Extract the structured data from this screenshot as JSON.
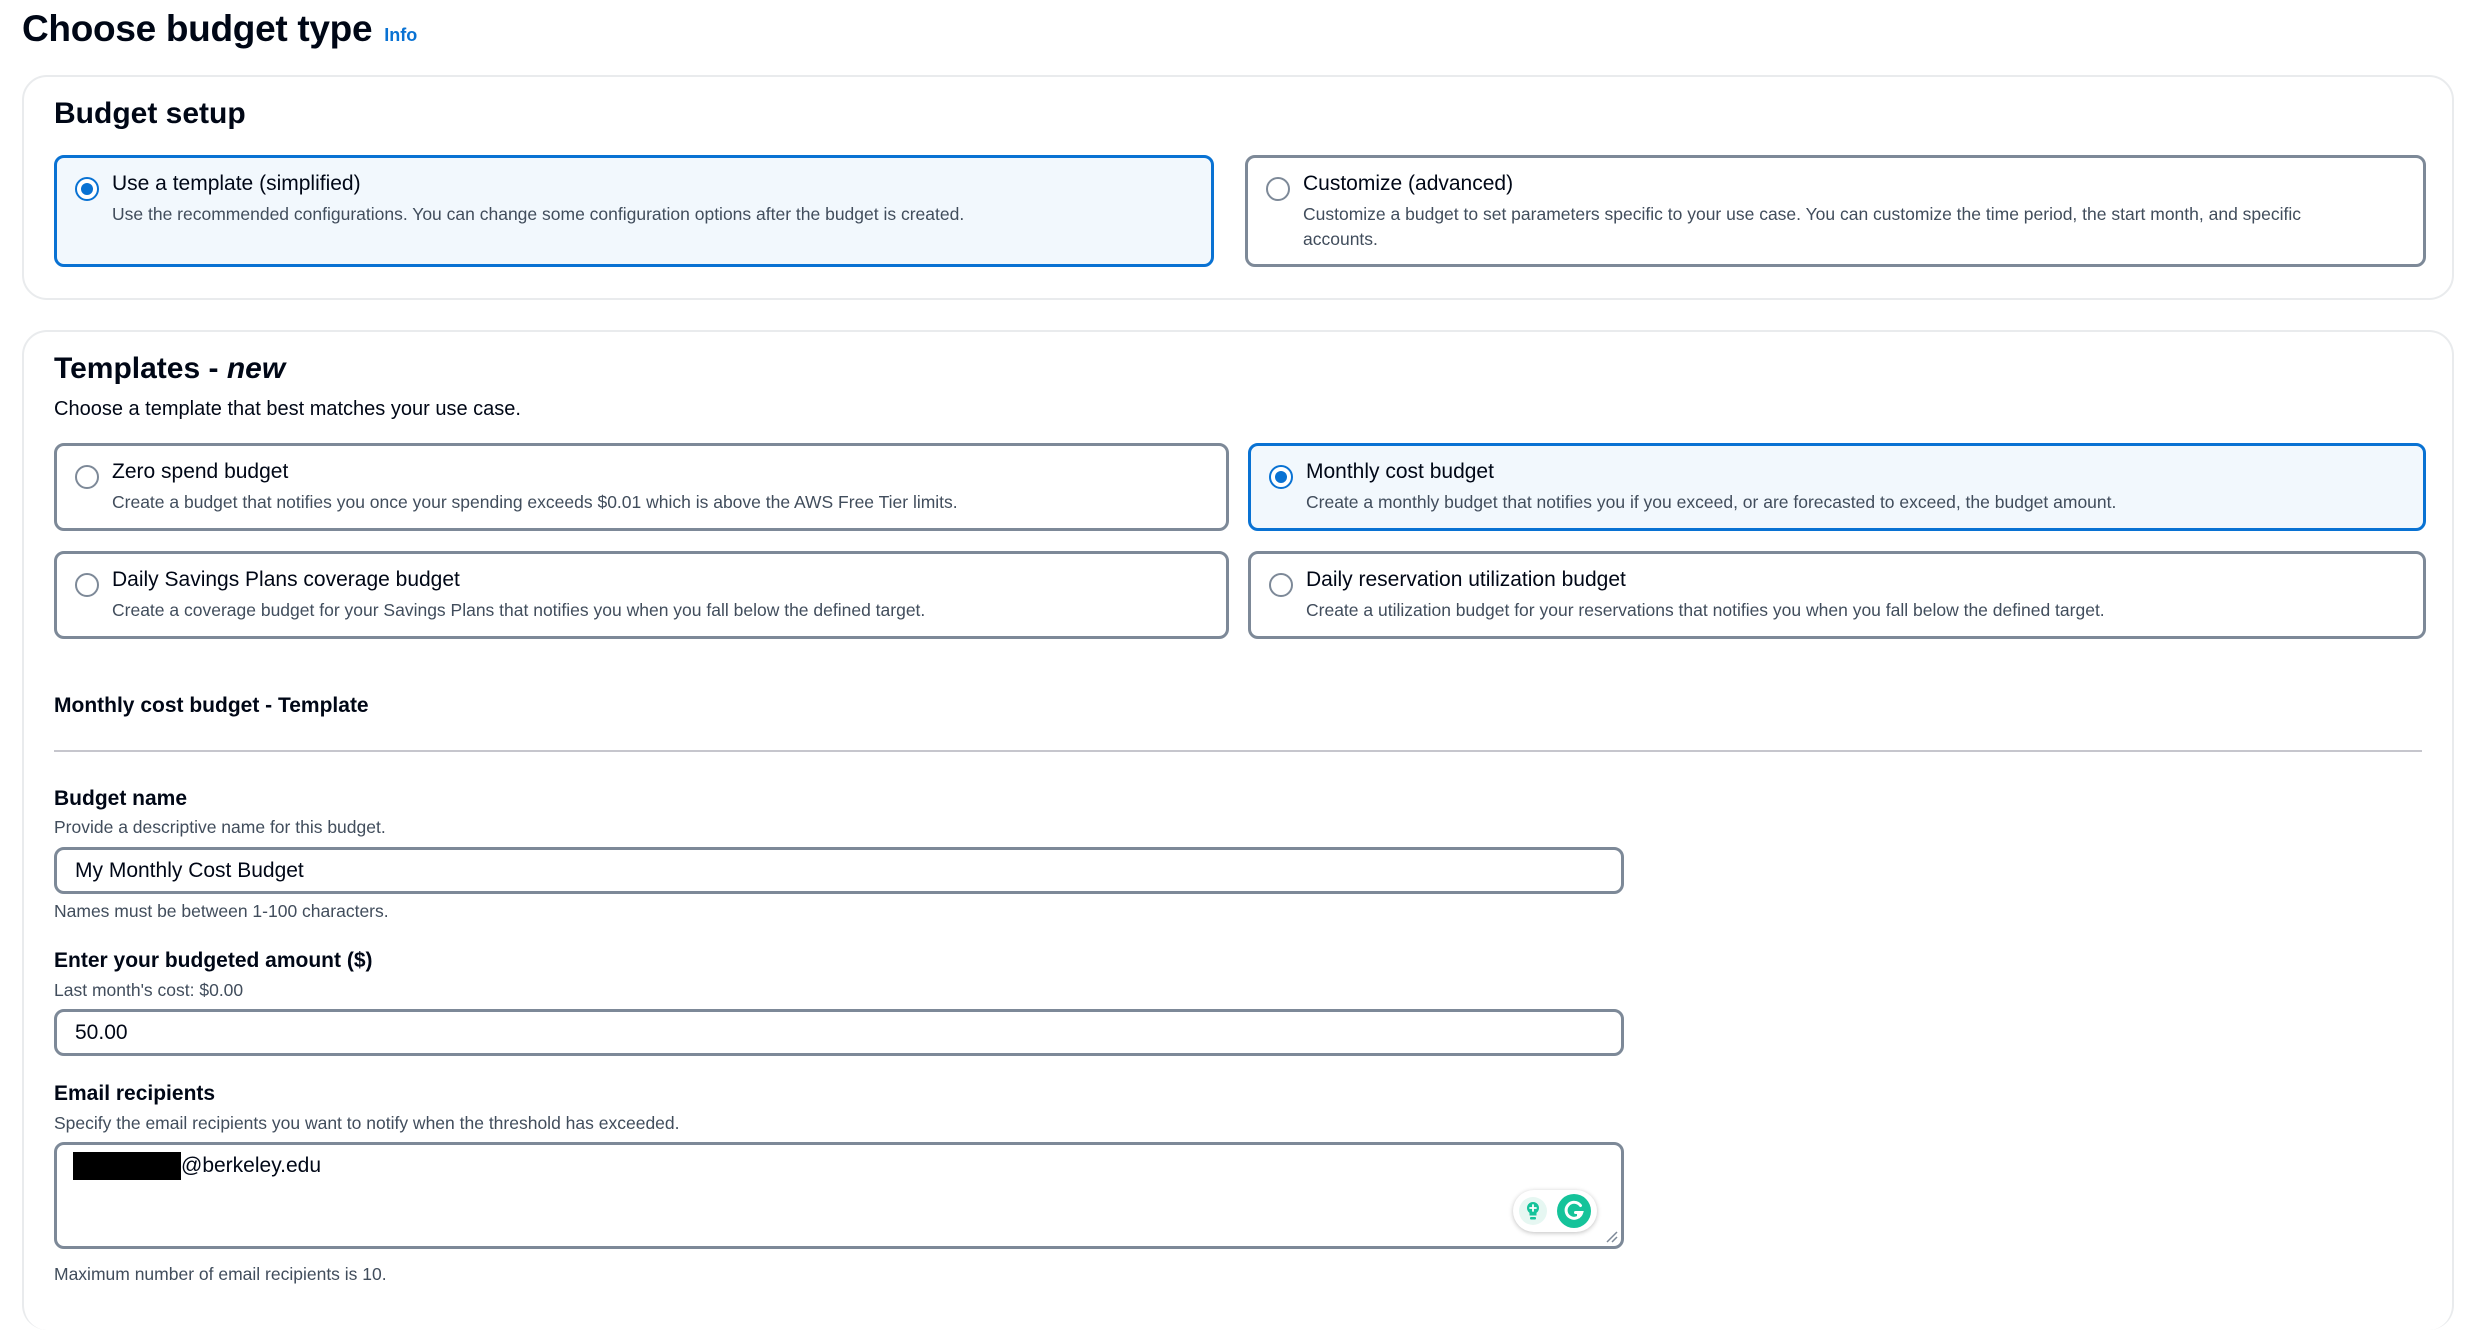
{
  "header": {
    "title": "Choose budget type",
    "info_link": "Info"
  },
  "budget_setup": {
    "heading": "Budget setup",
    "options": [
      {
        "title": "Use a template (simplified)",
        "description": "Use the recommended configurations. You can change some configuration options after the budget is created.",
        "selected": true
      },
      {
        "title": "Customize (advanced)",
        "description": "Customize a budget to set parameters specific to your use case. You can customize the time period, the start month, and specific accounts.",
        "selected": false
      }
    ]
  },
  "templates": {
    "heading": "Templates - ",
    "heading_suffix": "new",
    "subtitle": "Choose a template that best matches your use case.",
    "options": [
      {
        "title": "Zero spend budget",
        "description": "Create a budget that notifies you once your spending exceeds $0.01 which is above the AWS Free Tier limits.",
        "selected": false
      },
      {
        "title": "Monthly cost budget",
        "description": "Create a monthly budget that notifies you if you exceed, or are forecasted to exceed, the budget amount.",
        "selected": true
      },
      {
        "title": "Daily Savings Plans coverage budget",
        "description": "Create a coverage budget for your Savings Plans that notifies you when you fall below the defined target.",
        "selected": false
      },
      {
        "title": "Daily reservation utilization budget",
        "description": "Create a utilization budget for your reservations that notifies you when you fall below the defined target.",
        "selected": false
      }
    ]
  },
  "template_form": {
    "section_title": "Monthly cost budget - Template",
    "budget_name": {
      "label": "Budget name",
      "description": "Provide a descriptive name for this budget.",
      "value": "My Monthly Cost Budget",
      "hint": "Names must be between 1-100 characters."
    },
    "budgeted_amount": {
      "label": "Enter your budgeted amount ($)",
      "description": "Last month's cost: $0.00",
      "value": "50.00"
    },
    "email_recipients": {
      "label": "Email recipients",
      "description": "Specify the email recipients you want to notify when the threshold has exceeded.",
      "value_suffix": "@berkeley.edu",
      "hint": "Maximum number of email recipients is 10."
    }
  },
  "colors": {
    "accent": "#0972d3",
    "selected_bg": "#f2f8fd",
    "border": "#7d8998",
    "panel_border": "#e9ebed",
    "grammarly": "#15c39a"
  }
}
